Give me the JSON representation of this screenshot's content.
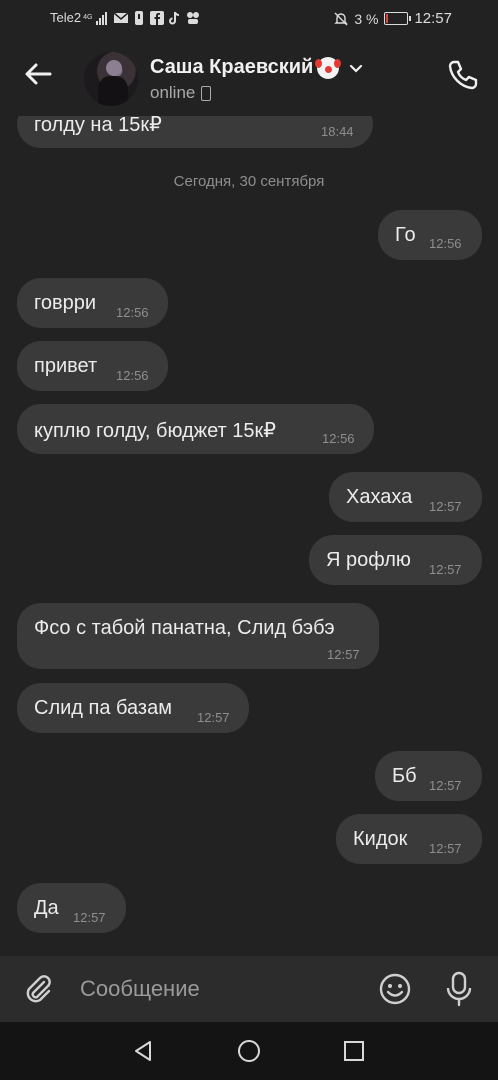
{
  "status_bar": {
    "carrier": "Tele2",
    "network": "4G",
    "battery_percent": "3 %",
    "time": "12:57",
    "icons": [
      "signal-icon",
      "mail-icon",
      "notification-icon",
      "facebook-icon",
      "tiktok-icon",
      "app-icon",
      "mute-icon",
      "battery-icon"
    ],
    "battery_color": "#e0463c"
  },
  "header": {
    "contact_name": "Саша Краевский",
    "name_emoji": "clown-face-icon",
    "status": "online",
    "icons": [
      "back-arrow-icon",
      "chevron-down-icon",
      "phone-icon"
    ]
  },
  "chat": {
    "date_separator": "Сегодня, 30 сентября",
    "messages": [
      {
        "direction": "incoming",
        "text": "голду на 15к₽",
        "time": "18:44"
      },
      {
        "direction": "outgoing",
        "text": "Го",
        "time": "12:56"
      },
      {
        "direction": "incoming",
        "text": "говрри",
        "time": "12:56"
      },
      {
        "direction": "incoming",
        "text": "привет",
        "time": "12:56"
      },
      {
        "direction": "incoming",
        "text": "куплю голду, бюджет 15к₽",
        "time": "12:56"
      },
      {
        "direction": "outgoing",
        "text": "Хахаха",
        "time": "12:57"
      },
      {
        "direction": "outgoing",
        "text": "Я рофлю",
        "time": "12:57"
      },
      {
        "direction": "incoming",
        "text": "Фсо с табой панатна, Слид бэбэ",
        "time": "12:57"
      },
      {
        "direction": "incoming",
        "text": "Слид па базам",
        "time": "12:57"
      },
      {
        "direction": "outgoing",
        "text": "Бб",
        "time": "12:57"
      },
      {
        "direction": "outgoing",
        "text": "Кидок",
        "time": "12:57"
      },
      {
        "direction": "incoming",
        "text": "Да",
        "time": "12:57"
      }
    ],
    "bubble_color": "#3a3a3a"
  },
  "composer": {
    "placeholder": "Сообщение",
    "icons": [
      "paperclip-icon",
      "emoji-icon",
      "microphone-icon"
    ]
  },
  "nav_bar": {
    "icons": [
      "nav-back-icon",
      "nav-home-icon",
      "nav-recent-icon"
    ]
  }
}
